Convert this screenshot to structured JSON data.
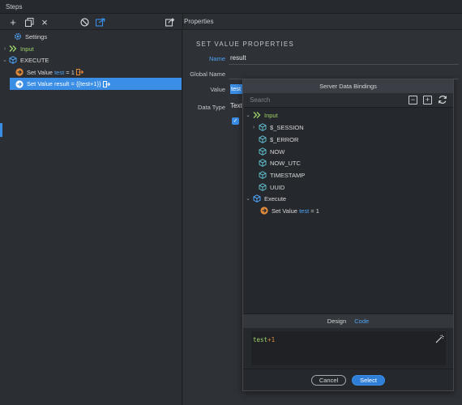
{
  "title_bar": {
    "title": "Steps"
  },
  "toolbar": {
    "add_label": "+",
    "close_label": "×",
    "properties_label": "Properties"
  },
  "steps_tree": {
    "settings": "Settings",
    "input": "Input",
    "execute": "EXECUTE",
    "step1_prefix": "Set Value",
    "step1_var": "test",
    "step1_suffix": "= 1",
    "step2_label": "Set Value result = {{test+1}}"
  },
  "properties": {
    "section_title": "SET VALUE PROPERTIES",
    "name_label": "Name",
    "name_value": "result",
    "global_name_label": "Global Name",
    "value_label": "Value",
    "value_value": "test",
    "data_type_label": "Data Type",
    "data_type_value": "Text",
    "check_mark": "✓"
  },
  "modal": {
    "title": "Server Data Bindings",
    "search_placeholder": "Search",
    "collapse_label": "−",
    "expand_label": "+",
    "tree": {
      "input": "Input",
      "session": "$_SESSION",
      "error": "$_ERROR",
      "now": "NOW",
      "now_utc": "NOW_UTC",
      "timestamp": "TIMESTAMP",
      "uuid": "UUID",
      "execute": "Execute",
      "setvalue_prefix": "Set Value",
      "setvalue_var": "test",
      "setvalue_suffix": "= 1"
    },
    "tabs": {
      "design": "Design",
      "code": "Code"
    },
    "code": {
      "var": "test",
      "op": "+1"
    },
    "buttons": {
      "cancel": "Cancel",
      "select": "Select"
    }
  },
  "colors": {
    "accent": "#3a8ee6",
    "input_green": "#9fd36b",
    "step_orange": "#e08a3c",
    "cube_teal": "#5fb8c9",
    "cube_blue": "#4fa3f7"
  }
}
